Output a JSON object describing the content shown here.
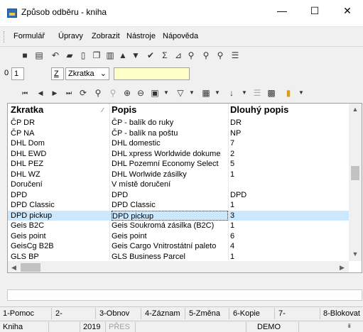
{
  "window": {
    "title": "Způsob odběru - kniha",
    "min": "—",
    "max": "☐",
    "close": "✕"
  },
  "menu": [
    "Formulář",
    "Úpravy",
    "Zobrazit",
    "Nástroje",
    "Nápověda"
  ],
  "filter": {
    "num0": "0",
    "num1": "1",
    "field_key": "Z",
    "field_select": "Zkratka",
    "field_value": ""
  },
  "grid": {
    "columns": [
      "Zkratka",
      "Popis",
      "Dlouhý popis"
    ],
    "rows": [
      [
        "ČP DR",
        "ČP - balík do ruky",
        "DR"
      ],
      [
        "ČP NA",
        "ČP - balík na poštu",
        "NP"
      ],
      [
        "DHL Dom",
        "DHL domestic",
        "7"
      ],
      [
        "DHL EWD",
        "DHL xpress Worldwide dokume",
        "2"
      ],
      [
        "DHL PEZ",
        "DHL Pozemní Economy Select",
        "5"
      ],
      [
        "DHL WZ",
        "DHL Worlwide zásilky",
        "1"
      ],
      [
        "Doručení",
        "V místě doručení",
        ""
      ],
      [
        "DPD",
        "DPD",
        "DPD"
      ],
      [
        "DPD Classic",
        "DPD Classic",
        "1"
      ],
      [
        "DPD pickup",
        "DPD pickup",
        "3"
      ],
      [
        "Geis B2C",
        "Geis Soukromá zásilka (B2C)",
        "1"
      ],
      [
        "Geis point",
        "Geis point",
        "6"
      ],
      [
        "GeisCg B2B",
        "Geis Cargo Vnitrostátní paleto",
        "4"
      ],
      [
        "GLS BP",
        "GLS Business Parcel",
        "1"
      ]
    ],
    "selected_index": 9
  },
  "function_keys": [
    "1-Pomoc",
    "2-",
    "3-Obnov",
    "4-Záznam",
    "5-Změna",
    "6-Kopie",
    "7-",
    "8-Blokovat"
  ],
  "status": {
    "module": "Kniha",
    "year": "2019",
    "mode": "PŘES",
    "db": "DEMO",
    "extra": "ii"
  }
}
